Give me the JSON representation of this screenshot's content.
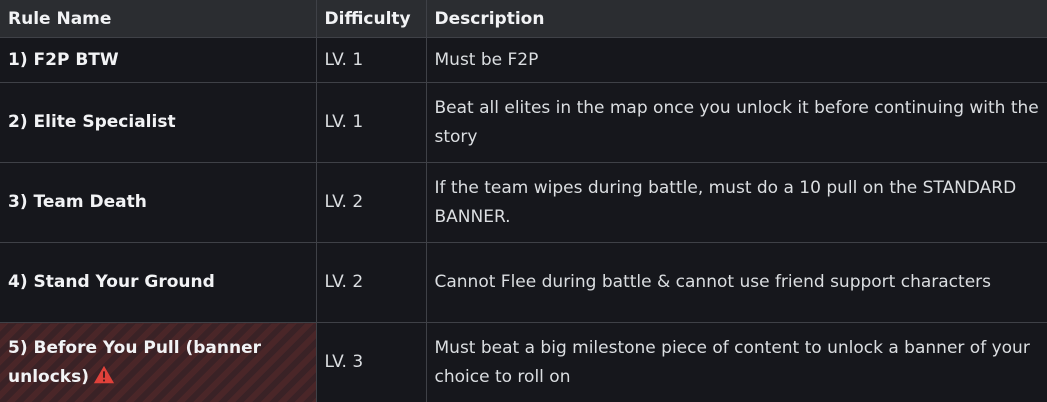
{
  "table": {
    "headers": [
      "Rule Name",
      "Difficulty",
      "Description"
    ],
    "rows": [
      {
        "name": "1) F2P BTW",
        "difficulty": "LV. 1",
        "description": "Must be F2P"
      },
      {
        "name": "2) Elite Specialist",
        "difficulty": "LV. 1",
        "description": "Beat all elites in the map once you unlock it before continuing with the story"
      },
      {
        "name": "3) Team Death",
        "difficulty": "LV. 2",
        "description": "If the team wipes during battle, must do a 10 pull on the STANDARD BANNER."
      },
      {
        "name": "4) Stand Your Ground",
        "difficulty": "LV. 2",
        "description": "Cannot Flee during battle & cannot use friend support characters"
      },
      {
        "name": "5) Before You Pull (banner unlocks)",
        "difficulty": "LV. 3",
        "description": "Must beat a big milestone piece of content to unlock a banner of your choice to roll on",
        "icon": "warning-icon"
      }
    ]
  },
  "colors": {
    "header_bg": "#2b2d31",
    "cell_bg": "#16171c",
    "border": "#3f4147",
    "danger_stripe": "#4a2628",
    "warning_red": "#e0413a"
  }
}
